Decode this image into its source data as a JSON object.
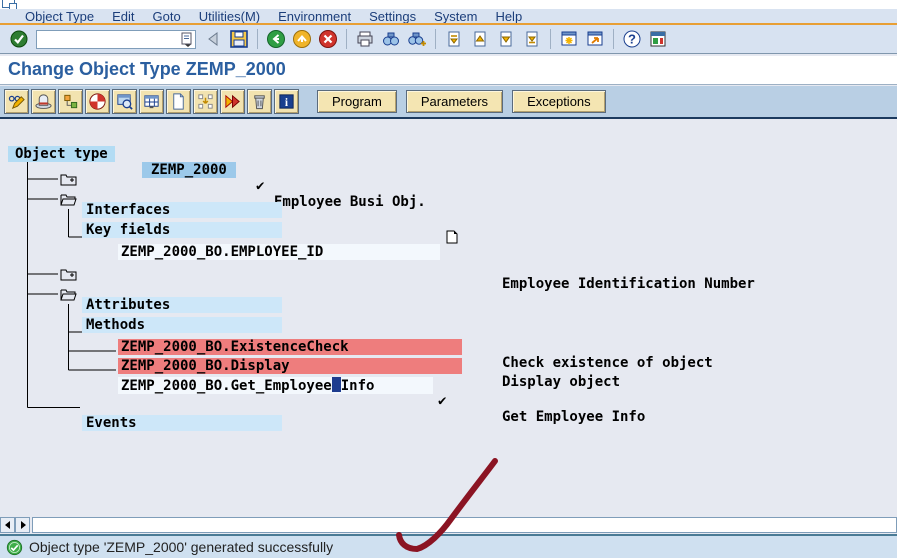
{
  "menu_bar": {
    "items": [
      "Object Type",
      "Edit",
      "Goto",
      "Utilities(M)",
      "Environment",
      "Settings",
      "System",
      "Help"
    ]
  },
  "toolbar": {
    "command_field": {
      "value": ""
    },
    "icons": [
      "enter-icon",
      "command-history-icon",
      "collapse-icon",
      "save-icon",
      "back-icon",
      "exit-icon",
      "cancel-icon",
      "print-icon",
      "find-icon",
      "find-next-icon",
      "first-page-icon",
      "previous-page-icon",
      "next-page-icon",
      "last-page-icon",
      "new-session-icon",
      "shortcut-icon",
      "help-icon",
      "customize-icon"
    ]
  },
  "page": {
    "title": "Change Object Type ZEMP_2000"
  },
  "app_toolbar": {
    "icons": [
      "display-change-icon",
      "test-icon",
      "program-structure-icon",
      "generate-icon",
      "display-object-icon",
      "table-view-icon",
      "create-icon",
      "where-used-icon",
      "execute-icon",
      "delete-icon",
      "documentation-icon"
    ],
    "buttons": [
      {
        "label": "Program"
      },
      {
        "label": "Parameters"
      },
      {
        "label": "Exceptions"
      }
    ]
  },
  "tree": {
    "header": {
      "label": "Object type",
      "value": "ZEMP_2000",
      "check": "✔",
      "description": "Employee Busi Obj."
    },
    "folders": [
      {
        "label": "Interfaces",
        "state": "closed"
      },
      {
        "label": "Key fields",
        "state": "open"
      },
      {
        "label": "Attributes",
        "state": "closed"
      },
      {
        "label": "Methods",
        "state": "open"
      },
      {
        "label": "Events",
        "state": "none"
      }
    ],
    "key_fields": [
      {
        "name": "ZEMP_2000_BO.EMPLOYEE_ID",
        "description": "Employee Identification Number"
      }
    ],
    "methods": [
      {
        "name": "ZEMP_2000_BO.ExistenceCheck",
        "description": "Check existence of object",
        "status": "error"
      },
      {
        "name": "ZEMP_2000_BO.Display",
        "description": "Display object",
        "status": "error"
      },
      {
        "name_before_cursor": "ZEMP_2000_BO.Get_Employee",
        "name_after_cursor": "Info",
        "check": "✔",
        "description": "Get Employee Info",
        "status": "ok"
      }
    ]
  },
  "annotation": {
    "type": "hand-drawn-checkmark",
    "color": "#8b1423"
  },
  "status_bar": {
    "icon": "success-check-icon",
    "message": "Object type 'ZEMP_2000' generated successfully"
  },
  "colors": {
    "error_row_bg": "#ee7d7d",
    "selected_row_bg": "#f3f8fd",
    "folder_highlight_bg": "#cde7f9",
    "header_label_bg": "#b3dcf4",
    "header_value_bg": "#9cc9ea",
    "title_text": "#2b5fa0",
    "menu_text": "#1c3e7a",
    "app_button_bg": "#f2e3b0",
    "status_bar_bg": "#cfe0f0",
    "annotation_stroke": "#8b1423",
    "orange_rule": "#e89f35"
  }
}
